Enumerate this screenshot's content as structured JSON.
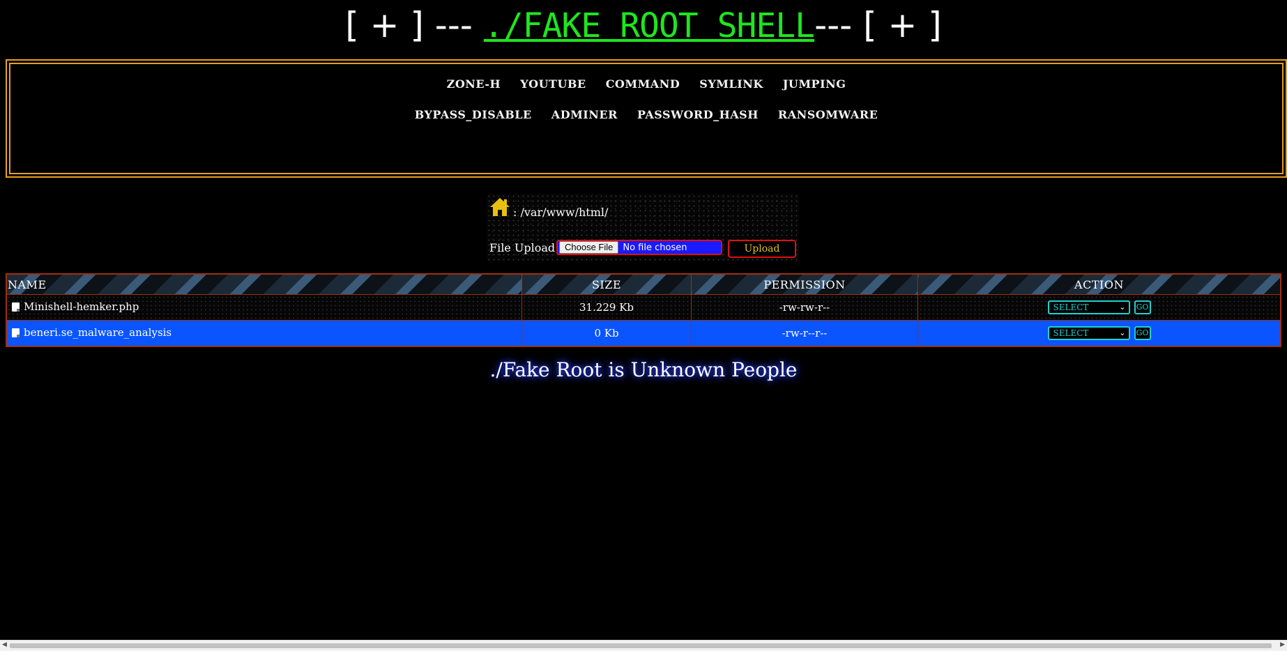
{
  "banner": {
    "prefix": "[ + ] --- ",
    "title": "./FAKE ROOT SHELL",
    "suffix": "--- [ + ]"
  },
  "nav": {
    "row1": [
      "ZONE-H",
      "YOUTUBE",
      "COMMAND",
      "SYMLINK",
      "JUMPING"
    ],
    "row2": [
      "BYPASS_DISABLE",
      "ADMINER",
      "PASSWORD_HASH",
      "RANSOMWARE"
    ]
  },
  "path": {
    "icon": "home-icon",
    "text": ": /var/www/html/"
  },
  "upload": {
    "label": "File Upload :",
    "choose_label": "Choose File",
    "chosen_text": "No file chosen",
    "button": "Upload"
  },
  "table": {
    "headers": [
      "NAME",
      "SIZE",
      "PERMISSION",
      "ACTION"
    ],
    "rows": [
      {
        "name": "Minishell-hemker.php",
        "size": "31.229 Kb",
        "permission": "-rw-rw-r--",
        "action": "SELECT",
        "go": "GO"
      },
      {
        "name": "beneri.se_malware_analysis",
        "size": "0 Kb",
        "permission": "-rw-r--r--",
        "action": "SELECT",
        "go": "GO"
      }
    ]
  },
  "footer": "./Fake Root is Unknown People",
  "colors": {
    "banner_link": "#1fe51f",
    "nav_border": "#e8a020",
    "selected_row": "#0a55ff",
    "accent_cyan": "#20d0d0",
    "upload_border": "#e01010"
  }
}
